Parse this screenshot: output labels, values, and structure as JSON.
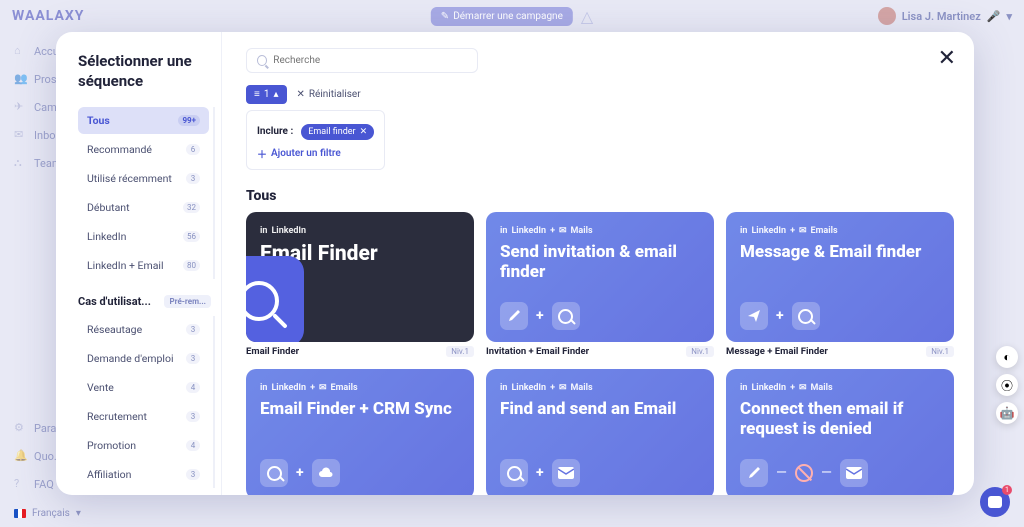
{
  "app": {
    "logo": "WAALAXY"
  },
  "topbar": {
    "campaign_btn": "Démarrer une campagne",
    "user_name": "Lisa J. Martinez"
  },
  "side_nav": [
    "Accu...",
    "Pros...",
    "Camp...",
    "Inbo...",
    "Team..."
  ],
  "side_bottom": [
    "Para...",
    "Quo...",
    "FAQ"
  ],
  "lang": {
    "label": "Français"
  },
  "modal": {
    "title": "Sélectionner une séquence",
    "search_placeholder": "Recherche",
    "filter_chip": "1",
    "reset": "Réinitialiser",
    "include_label": "Inclure :",
    "include_tag": "Email finder",
    "add_filter": "Ajouter un filtre",
    "section_title": "Tous",
    "categories": [
      {
        "label": "Tous",
        "count": "99+",
        "active": true
      },
      {
        "label": "Recommandé",
        "count": "6"
      },
      {
        "label": "Utilisé récemment",
        "count": "3"
      },
      {
        "label": "Débutant",
        "count": "32"
      },
      {
        "label": "LinkedIn",
        "count": "56"
      },
      {
        "label": "LinkedIn + Email",
        "count": "80"
      }
    ],
    "usecase_header": "Cas d'utilisat...",
    "usecase_badge": "Pré-rem...",
    "usecases": [
      {
        "label": "Réseautage",
        "count": "3"
      },
      {
        "label": "Demande d'emploi",
        "count": "3"
      },
      {
        "label": "Vente",
        "count": "4"
      },
      {
        "label": "Recrutement",
        "count": "3"
      },
      {
        "label": "Promotion",
        "count": "4"
      },
      {
        "label": "Affiliation",
        "count": "3"
      }
    ],
    "cards": [
      {
        "tags": [
          "LinkedIn"
        ],
        "title": "Email Finder",
        "sub": "Email Finder",
        "lvl": "Niv.1",
        "dark": true
      },
      {
        "tags": [
          "LinkedIn",
          "+",
          "Mails"
        ],
        "title": "Send invitation & email finder",
        "sub": "Invitation + Email Finder",
        "lvl": "Niv.1"
      },
      {
        "tags": [
          "LinkedIn",
          "+",
          "Emails"
        ],
        "title": "Message & Email finder",
        "sub": "Message + Email Finder",
        "lvl": "Niv.1"
      },
      {
        "tags": [
          "LinkedIn",
          "+",
          "Emails"
        ],
        "title": "Email Finder + CRM Sync",
        "sub": "",
        "lvl": ""
      },
      {
        "tags": [
          "LinkedIn",
          "+",
          "Mails"
        ],
        "title": "Find and send an Email",
        "sub": "",
        "lvl": ""
      },
      {
        "tags": [
          "LinkedIn",
          "+",
          "Mails"
        ],
        "title": "Connect then email if request is denied",
        "sub": "",
        "lvl": ""
      }
    ]
  },
  "chat_badge": "1"
}
